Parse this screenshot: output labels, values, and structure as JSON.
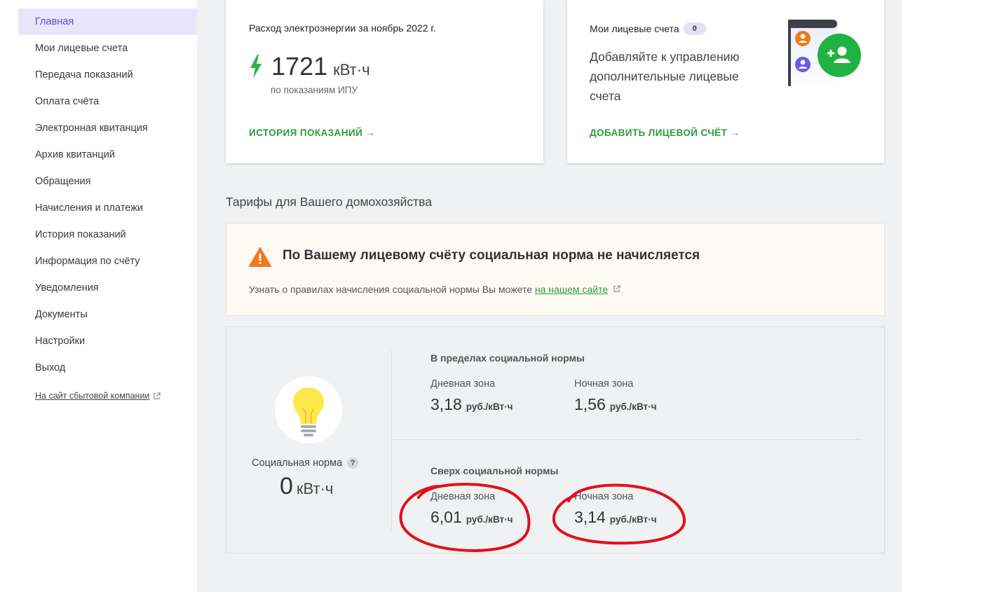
{
  "sidebar": {
    "items": [
      {
        "label": "Главная",
        "active": true
      },
      {
        "label": "Мои лицевые счета"
      },
      {
        "label": "Передача показаний"
      },
      {
        "label": "Оплата счёта"
      },
      {
        "label": "Электронная квитанция"
      },
      {
        "label": "Архив квитанций"
      },
      {
        "label": "Обращения"
      },
      {
        "label": "Начисления и платежи"
      },
      {
        "label": "История показаний"
      },
      {
        "label": "Информация по счёту"
      },
      {
        "label": "Уведомления"
      },
      {
        "label": "Документы"
      },
      {
        "label": "Настройки"
      },
      {
        "label": "Выход"
      }
    ],
    "external_link": "На сайт сбытовой компании"
  },
  "consumption_card": {
    "title": "Расход электроэнергии за ноябрь 2022 г.",
    "value": "1721",
    "unit": "кВт·ч",
    "subtitle": "по показаниям ИПУ",
    "link": "ИСТОРИЯ ПОКАЗАНИЙ →"
  },
  "accounts_card": {
    "title": "Мои лицевые счета",
    "badge": "0",
    "description": "Добавляйте к управлению дополнительные лицевые счета",
    "link": "ДОБАВИТЬ ЛИЦЕВОЙ СЧЁТ →"
  },
  "tariffs": {
    "section_title": "Тарифы для Вашего домохозяйства",
    "warning_title": "По Вашему лицевому счёту социальная норма не начисляется",
    "warning_text": "Узнать о правилах начисления социальной нормы Вы можете ",
    "warning_link": "на нашем сайте",
    "social_norm_label": "Социальная норма",
    "social_norm_help": "?",
    "social_norm_value": "0",
    "social_norm_unit": "кВт·ч",
    "within": {
      "title": "В пределах социальной нормы",
      "day_label": "Дневная зона",
      "day_value": "3,18",
      "night_label": "Ночная зона",
      "night_value": "1,56"
    },
    "above": {
      "title": "Сверх социальной нормы",
      "day_label": "Дневная зона",
      "day_value": "6,01",
      "night_label": "Ночная зона",
      "night_value": "3,14"
    },
    "rate_unit": "руб./кВт·ч"
  },
  "colors": {
    "accent_green": "#2a9d3d",
    "active_nav_bg": "#e9e6fb",
    "active_nav_text": "#5b4bd6",
    "warning_orange": "#f07a1b",
    "annotation_red": "#e0101e"
  }
}
